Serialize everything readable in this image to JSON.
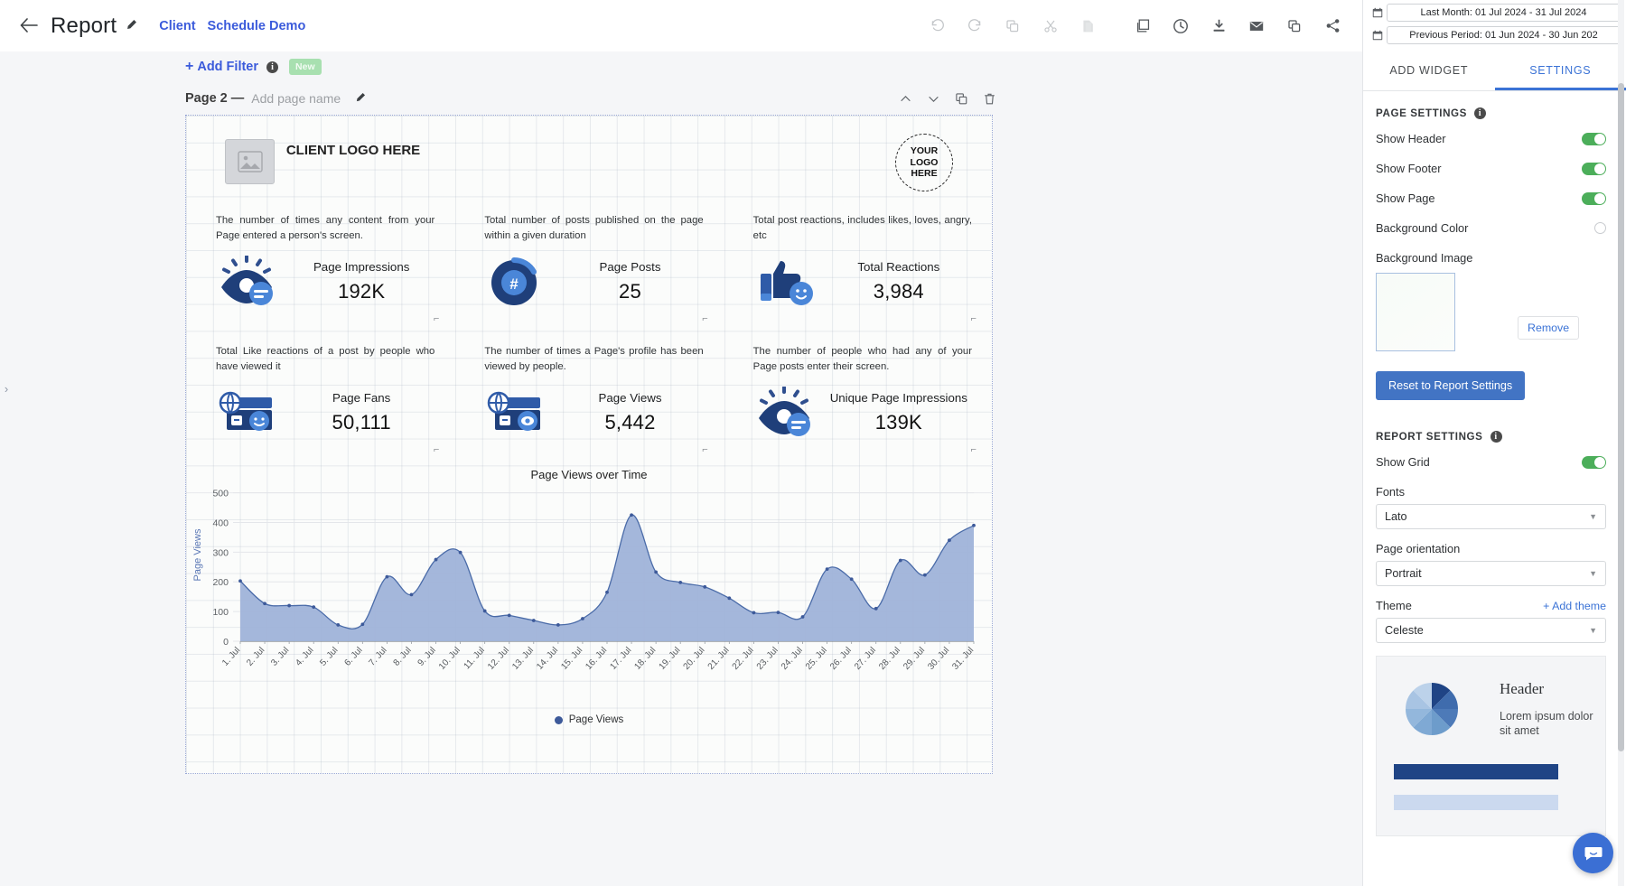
{
  "topbar": {
    "back_icon": "arrow-left-icon",
    "title": "Report",
    "edit_icon": "pencil-icon",
    "breadcrumb_client": "Client",
    "breadcrumb_demo": "Schedule Demo",
    "tools": [
      {
        "name": "undo-icon",
        "disabled": true
      },
      {
        "name": "redo-icon",
        "disabled": true
      },
      {
        "name": "duplicate-icon",
        "disabled": true
      },
      {
        "name": "cut-icon",
        "disabled": true
      },
      {
        "name": "paste-icon",
        "disabled": true
      },
      {
        "name": "pages-icon",
        "disabled": false
      },
      {
        "name": "history-clock-icon",
        "disabled": false
      },
      {
        "name": "download-icon",
        "disabled": false
      },
      {
        "name": "email-icon",
        "disabled": false
      },
      {
        "name": "copy-report-icon",
        "disabled": false
      },
      {
        "name": "share-icon",
        "disabled": false
      }
    ]
  },
  "filterbar": {
    "add_filter": "Add Filter",
    "plus": "+",
    "info": "i",
    "new_badge": "New"
  },
  "page_header": {
    "title": "Page 2 —",
    "placeholder_name": "Add page name",
    "actions": [
      "move-up-icon",
      "move-down-icon",
      "duplicate-page-icon",
      "delete-page-icon"
    ]
  },
  "report": {
    "client_logo_text": "CLIENT LOGO HERE",
    "your_logo_text": "YOUR LOGO HERE",
    "kpis": [
      {
        "desc": "The number of times any content from your Page  entered a person's screen.",
        "label": "Page Impressions",
        "value": "192K",
        "icon": "eye-impressions-icon"
      },
      {
        "desc": "Total number of posts published on the page within a given duration",
        "label": "Page Posts",
        "value": "25",
        "icon": "hashtag-posts-icon"
      },
      {
        "desc": "Total post reactions, includes likes, loves, angry, etc",
        "label": "Total Reactions",
        "value": "3,984",
        "icon": "thumbs-up-reactions-icon"
      },
      {
        "desc": "Total Like reactions of a post by people who have viewed it",
        "label": "Page Fans",
        "value": "50,111",
        "icon": "globe-fans-icon"
      },
      {
        "desc": "The number of times a Page's profile has been viewed by people.",
        "label": "Page Views",
        "value": "5,442",
        "icon": "globe-views-icon"
      },
      {
        "desc": "The number of people who had any of your Page posts enter their screen.",
        "label": "Unique Page Impressions",
        "value": "139K",
        "icon": "eye-unique-icon"
      }
    ],
    "resize_handle": "⌐"
  },
  "chart_data": {
    "type": "area",
    "title": "Page Views over Time",
    "xlabel": "",
    "ylabel": "Page Views",
    "ylim": [
      0,
      520
    ],
    "yticks": [
      0,
      100,
      200,
      300,
      400,
      500
    ],
    "grid": true,
    "legend_position": "bottom",
    "legend": [
      "Page Views"
    ],
    "categories": [
      "1. Jul",
      "2. Jul",
      "3. Jul",
      "4. Jul",
      "5. Jul",
      "6. Jul",
      "7. Jul",
      "8. Jul",
      "9. Jul",
      "10. Jul",
      "11. Jul",
      "12. Jul",
      "13. Jul",
      "14. Jul",
      "15. Jul",
      "16. Jul",
      "17. Jul",
      "18. Jul",
      "19. Jul",
      "20. Jul",
      "21. Jul",
      "22. Jul",
      "23. Jul",
      "24. Jul",
      "25. Jul",
      "26. Jul",
      "27. Jul",
      "28. Jul",
      "29. Jul",
      "30. Jul",
      "31. Jul"
    ],
    "series": [
      {
        "name": "Page Views",
        "color": "#4a6ba8",
        "fill": "#9fb3d9",
        "values": [
          203,
          127,
          120,
          115,
          55,
          57,
          217,
          157,
          275,
          299,
          102,
          87,
          70,
          55,
          76,
          165,
          425,
          233,
          198,
          183,
          145,
          96,
          97,
          82,
          243,
          209,
          110,
          272,
          223,
          340,
          390
        ]
      }
    ],
    "note_extra_points": [
      199,
      178
    ]
  },
  "right_panel": {
    "date_ranges": [
      {
        "icon": "calendar-icon",
        "value": "Last Month: 01 Jul 2024 - 31 Jul 2024"
      },
      {
        "icon": "calendar-icon",
        "value": "Previous Period: 01 Jun 2024 - 30 Jun 202"
      }
    ],
    "tabs": [
      {
        "label": "ADD WIDGET",
        "active": false
      },
      {
        "label": "SETTINGS",
        "active": true
      }
    ],
    "page_settings": {
      "heading": "PAGE SETTINGS",
      "info": "i",
      "rows": [
        {
          "label": "Show Header",
          "type": "toggle",
          "on": true
        },
        {
          "label": "Show Footer",
          "type": "toggle",
          "on": true
        },
        {
          "label": "Show Page",
          "type": "toggle",
          "on": true
        },
        {
          "label": "Background Color",
          "type": "radio",
          "on": false
        }
      ],
      "background_image_label": "Background Image",
      "remove_label": "Remove",
      "reset_label": "Reset to Report Settings"
    },
    "report_settings": {
      "heading": "REPORT SETTINGS",
      "info": "i",
      "show_grid_label": "Show Grid",
      "show_grid_on": true,
      "fonts_label": "Fonts",
      "fonts_value": "Lato",
      "orientation_label": "Page orientation",
      "orientation_value": "Portrait",
      "theme_label": "Theme",
      "add_theme_label": "+ Add theme",
      "theme_value": "Celeste"
    },
    "theme_preview": {
      "header": "Header",
      "lorem": "Lorem ipsum dolor sit amet"
    },
    "chat_icon": "chat-bubble-icon"
  },
  "colors": {
    "accent_blue": "#3b73d6",
    "brand_indigo": "#3b5bdb",
    "toggle_green": "#4cae5a",
    "chart_line": "#4a6ba8",
    "chart_fill": "#9fb3d9",
    "primary_button": "#4274c4"
  }
}
